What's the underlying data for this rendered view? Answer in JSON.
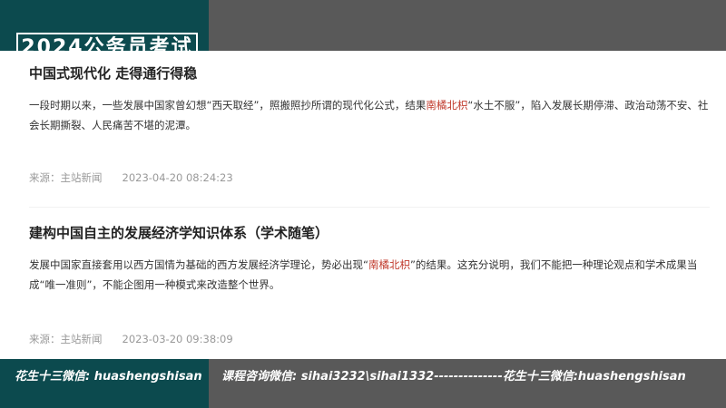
{
  "banner": {
    "text": "2024公务员考试"
  },
  "articles": [
    {
      "title": "中国式现代化 走得通行得稳",
      "body_pre": "一段时期以来，一些发展中国家曾幻想“西天取经”，照搬照抄所谓的现代化公式，结果",
      "highlight": "南橘北枳",
      "body_post": "“水土不服”，陷入发展长期停滞、政治动荡不安、社会长期撕裂、人民痛苦不堪的泥潭。",
      "source": "来源：主站新闻",
      "timestamp": "2023-04-20 08:24:23"
    },
    {
      "title": "建构中国自主的发展经济学知识体系（学术随笔）",
      "body_pre": "发展中国家直接套用以西方国情为基础的西方发展经济学理论，势必出现“",
      "highlight": "南橘北枳",
      "body_post": "”的结果。这充分说明，我们不能把一种理论观点和学术成果当成“唯一准则”，不能企图用一种模式来改造整个世界。",
      "source": "来源：主站新闻",
      "timestamp": "2023-03-20 09:38:09"
    }
  ],
  "footer": {
    "left": "花生十三微信: huashengshisan",
    "right": "课程咨询微信: sihai3232\\sihai1332--------------花生十三微信:huashengshisan"
  },
  "colors": {
    "left_panel": "#0c4a4e",
    "right_panel": "#595959",
    "highlight": "#c0392b"
  }
}
